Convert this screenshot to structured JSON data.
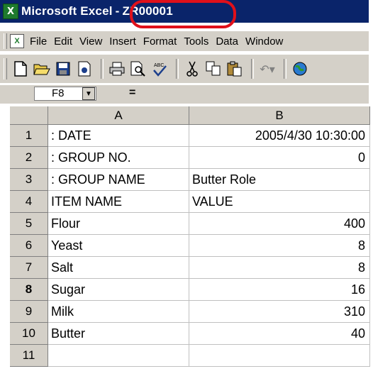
{
  "window": {
    "app_name": "Microsoft Excel",
    "separator": "-",
    "doc_name": "ZR00001"
  },
  "menu": [
    "File",
    "Edit",
    "View",
    "Insert",
    "Format",
    "Tools",
    "Data",
    "Window"
  ],
  "toolbar": {
    "icons": [
      "new-icon",
      "open-icon",
      "save-icon",
      "permission-icon",
      "print-icon",
      "print-preview-icon",
      "spelling-icon",
      "cut-icon",
      "copy-icon",
      "paste-icon",
      "undo-icon",
      "hyperlink-icon"
    ]
  },
  "formula_bar": {
    "name_box": "F8",
    "equals": "=",
    "value": ""
  },
  "sheet": {
    "columns": [
      "A",
      "B"
    ],
    "rows": [
      {
        "num": "1",
        "a": ": DATE",
        "b": "2005/4/30 10:30:00"
      },
      {
        "num": "2",
        "a": ": GROUP NO.",
        "b": "0"
      },
      {
        "num": "3",
        "a": ": GROUP NAME",
        "b": "Butter Role"
      },
      {
        "num": "4",
        "a": "ITEM NAME",
        "b": "VALUE"
      },
      {
        "num": "5",
        "a": "Flour",
        "b": "400"
      },
      {
        "num": "6",
        "a": "Yeast",
        "b": "8"
      },
      {
        "num": "7",
        "a": "Salt",
        "b": "8"
      },
      {
        "num": "8",
        "a": "Sugar",
        "b": "16"
      },
      {
        "num": "9",
        "a": "Milk",
        "b": "310"
      },
      {
        "num": "10",
        "a": "Butter",
        "b": "40"
      },
      {
        "num": "11",
        "a": "",
        "b": ""
      }
    ]
  },
  "colors": {
    "titlebar": "#0a246a",
    "highlight": "#e0101a",
    "chrome": "#d4d0c8"
  }
}
